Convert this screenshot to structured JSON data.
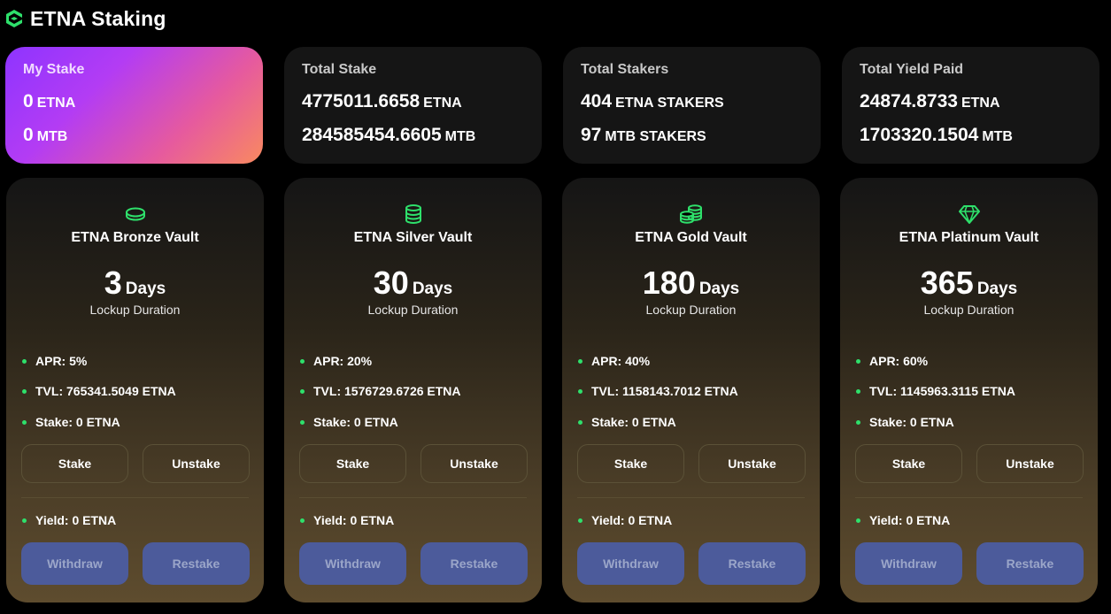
{
  "header": {
    "title": "ETNA Staking",
    "logo_icon": "etna-logo-icon"
  },
  "stats": [
    {
      "label": "My Stake",
      "lines": [
        {
          "num": "0",
          "unit": "ETNA"
        },
        {
          "num": "0",
          "unit": "MTB"
        }
      ]
    },
    {
      "label": "Total Stake",
      "lines": [
        {
          "num": "4775011.6658",
          "unit": "ETNA"
        },
        {
          "num": "284585454.6605",
          "unit": "MTB"
        }
      ]
    },
    {
      "label": "Total Stakers",
      "lines": [
        {
          "num": "404",
          "unit": "ETNA STAKERS"
        },
        {
          "num": "97",
          "unit": "MTB STAKERS"
        }
      ]
    },
    {
      "label": "Total Yield Paid",
      "lines": [
        {
          "num": "24874.8733",
          "unit": "ETNA"
        },
        {
          "num": "1703320.1504",
          "unit": "MTB"
        }
      ]
    }
  ],
  "vaults": [
    {
      "icon": "coin-icon",
      "name": "ETNA Bronze Vault",
      "days": "3",
      "days_label": "Days",
      "lockup": "Lockup Duration",
      "apr": "APR: 5%",
      "tvl": "TVL: 765341.5049 ETNA",
      "stake": "Stake: 0 ETNA",
      "yield": "Yield: 0 ETNA",
      "stake_btn": "Stake",
      "unstake_btn": "Unstake",
      "withdraw_btn": "Withdraw",
      "restake_btn": "Restake"
    },
    {
      "icon": "coin-stack-icon",
      "name": "ETNA Silver Vault",
      "days": "30",
      "days_label": "Days",
      "lockup": "Lockup Duration",
      "apr": "APR: 20%",
      "tvl": "TVL: 1576729.6726 ETNA",
      "stake": "Stake: 0 ETNA",
      "yield": "Yield: 0 ETNA",
      "stake_btn": "Stake",
      "unstake_btn": "Unstake",
      "withdraw_btn": "Withdraw",
      "restake_btn": "Restake"
    },
    {
      "icon": "coins-icon",
      "name": "ETNA Gold Vault",
      "days": "180",
      "days_label": "Days",
      "lockup": "Lockup Duration",
      "apr": "APR: 40%",
      "tvl": "TVL: 1158143.7012 ETNA",
      "stake": "Stake: 0 ETNA",
      "yield": "Yield: 0 ETNA",
      "stake_btn": "Stake",
      "unstake_btn": "Unstake",
      "withdraw_btn": "Withdraw",
      "restake_btn": "Restake"
    },
    {
      "icon": "diamond-icon",
      "name": "ETNA Platinum Vault",
      "days": "365",
      "days_label": "Days",
      "lockup": "Lockup Duration",
      "apr": "APR: 60%",
      "tvl": "TVL: 1145963.3115 ETNA",
      "stake": "Stake: 0 ETNA",
      "yield": "Yield: 0 ETNA",
      "stake_btn": "Stake",
      "unstake_btn": "Unstake",
      "withdraw_btn": "Withdraw",
      "restake_btn": "Restake"
    }
  ],
  "colors": {
    "accent": "#2ee06b",
    "button_blue": "#4c5b9b",
    "card_bg": "#151515"
  }
}
